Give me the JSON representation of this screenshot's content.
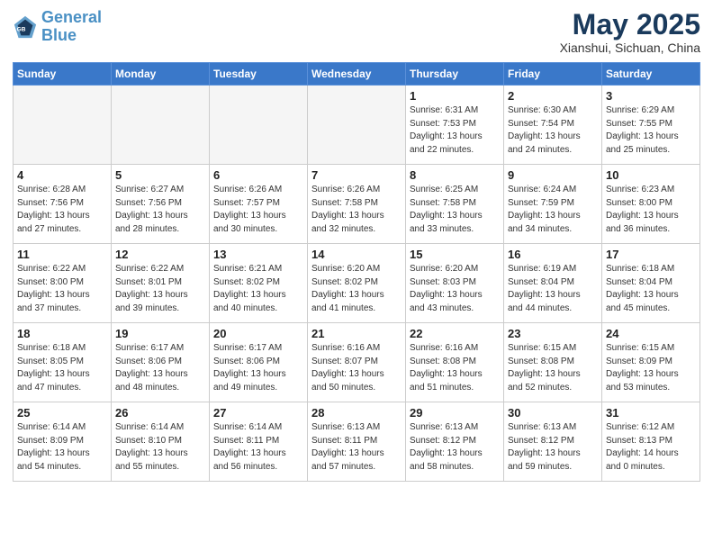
{
  "logo": {
    "line1": "General",
    "line2": "Blue"
  },
  "title": "May 2025",
  "subtitle": "Xianshui, Sichuan, China",
  "weekdays": [
    "Sunday",
    "Monday",
    "Tuesday",
    "Wednesday",
    "Thursday",
    "Friday",
    "Saturday"
  ],
  "weeks": [
    [
      {
        "day": "",
        "info": ""
      },
      {
        "day": "",
        "info": ""
      },
      {
        "day": "",
        "info": ""
      },
      {
        "day": "",
        "info": ""
      },
      {
        "day": "1",
        "info": "Sunrise: 6:31 AM\nSunset: 7:53 PM\nDaylight: 13 hours\nand 22 minutes."
      },
      {
        "day": "2",
        "info": "Sunrise: 6:30 AM\nSunset: 7:54 PM\nDaylight: 13 hours\nand 24 minutes."
      },
      {
        "day": "3",
        "info": "Sunrise: 6:29 AM\nSunset: 7:55 PM\nDaylight: 13 hours\nand 25 minutes."
      }
    ],
    [
      {
        "day": "4",
        "info": "Sunrise: 6:28 AM\nSunset: 7:56 PM\nDaylight: 13 hours\nand 27 minutes."
      },
      {
        "day": "5",
        "info": "Sunrise: 6:27 AM\nSunset: 7:56 PM\nDaylight: 13 hours\nand 28 minutes."
      },
      {
        "day": "6",
        "info": "Sunrise: 6:26 AM\nSunset: 7:57 PM\nDaylight: 13 hours\nand 30 minutes."
      },
      {
        "day": "7",
        "info": "Sunrise: 6:26 AM\nSunset: 7:58 PM\nDaylight: 13 hours\nand 32 minutes."
      },
      {
        "day": "8",
        "info": "Sunrise: 6:25 AM\nSunset: 7:58 PM\nDaylight: 13 hours\nand 33 minutes."
      },
      {
        "day": "9",
        "info": "Sunrise: 6:24 AM\nSunset: 7:59 PM\nDaylight: 13 hours\nand 34 minutes."
      },
      {
        "day": "10",
        "info": "Sunrise: 6:23 AM\nSunset: 8:00 PM\nDaylight: 13 hours\nand 36 minutes."
      }
    ],
    [
      {
        "day": "11",
        "info": "Sunrise: 6:22 AM\nSunset: 8:00 PM\nDaylight: 13 hours\nand 37 minutes."
      },
      {
        "day": "12",
        "info": "Sunrise: 6:22 AM\nSunset: 8:01 PM\nDaylight: 13 hours\nand 39 minutes."
      },
      {
        "day": "13",
        "info": "Sunrise: 6:21 AM\nSunset: 8:02 PM\nDaylight: 13 hours\nand 40 minutes."
      },
      {
        "day": "14",
        "info": "Sunrise: 6:20 AM\nSunset: 8:02 PM\nDaylight: 13 hours\nand 41 minutes."
      },
      {
        "day": "15",
        "info": "Sunrise: 6:20 AM\nSunset: 8:03 PM\nDaylight: 13 hours\nand 43 minutes."
      },
      {
        "day": "16",
        "info": "Sunrise: 6:19 AM\nSunset: 8:04 PM\nDaylight: 13 hours\nand 44 minutes."
      },
      {
        "day": "17",
        "info": "Sunrise: 6:18 AM\nSunset: 8:04 PM\nDaylight: 13 hours\nand 45 minutes."
      }
    ],
    [
      {
        "day": "18",
        "info": "Sunrise: 6:18 AM\nSunset: 8:05 PM\nDaylight: 13 hours\nand 47 minutes."
      },
      {
        "day": "19",
        "info": "Sunrise: 6:17 AM\nSunset: 8:06 PM\nDaylight: 13 hours\nand 48 minutes."
      },
      {
        "day": "20",
        "info": "Sunrise: 6:17 AM\nSunset: 8:06 PM\nDaylight: 13 hours\nand 49 minutes."
      },
      {
        "day": "21",
        "info": "Sunrise: 6:16 AM\nSunset: 8:07 PM\nDaylight: 13 hours\nand 50 minutes."
      },
      {
        "day": "22",
        "info": "Sunrise: 6:16 AM\nSunset: 8:08 PM\nDaylight: 13 hours\nand 51 minutes."
      },
      {
        "day": "23",
        "info": "Sunrise: 6:15 AM\nSunset: 8:08 PM\nDaylight: 13 hours\nand 52 minutes."
      },
      {
        "day": "24",
        "info": "Sunrise: 6:15 AM\nSunset: 8:09 PM\nDaylight: 13 hours\nand 53 minutes."
      }
    ],
    [
      {
        "day": "25",
        "info": "Sunrise: 6:14 AM\nSunset: 8:09 PM\nDaylight: 13 hours\nand 54 minutes."
      },
      {
        "day": "26",
        "info": "Sunrise: 6:14 AM\nSunset: 8:10 PM\nDaylight: 13 hours\nand 55 minutes."
      },
      {
        "day": "27",
        "info": "Sunrise: 6:14 AM\nSunset: 8:11 PM\nDaylight: 13 hours\nand 56 minutes."
      },
      {
        "day": "28",
        "info": "Sunrise: 6:13 AM\nSunset: 8:11 PM\nDaylight: 13 hours\nand 57 minutes."
      },
      {
        "day": "29",
        "info": "Sunrise: 6:13 AM\nSunset: 8:12 PM\nDaylight: 13 hours\nand 58 minutes."
      },
      {
        "day": "30",
        "info": "Sunrise: 6:13 AM\nSunset: 8:12 PM\nDaylight: 13 hours\nand 59 minutes."
      },
      {
        "day": "31",
        "info": "Sunrise: 6:12 AM\nSunset: 8:13 PM\nDaylight: 14 hours\nand 0 minutes."
      }
    ]
  ]
}
